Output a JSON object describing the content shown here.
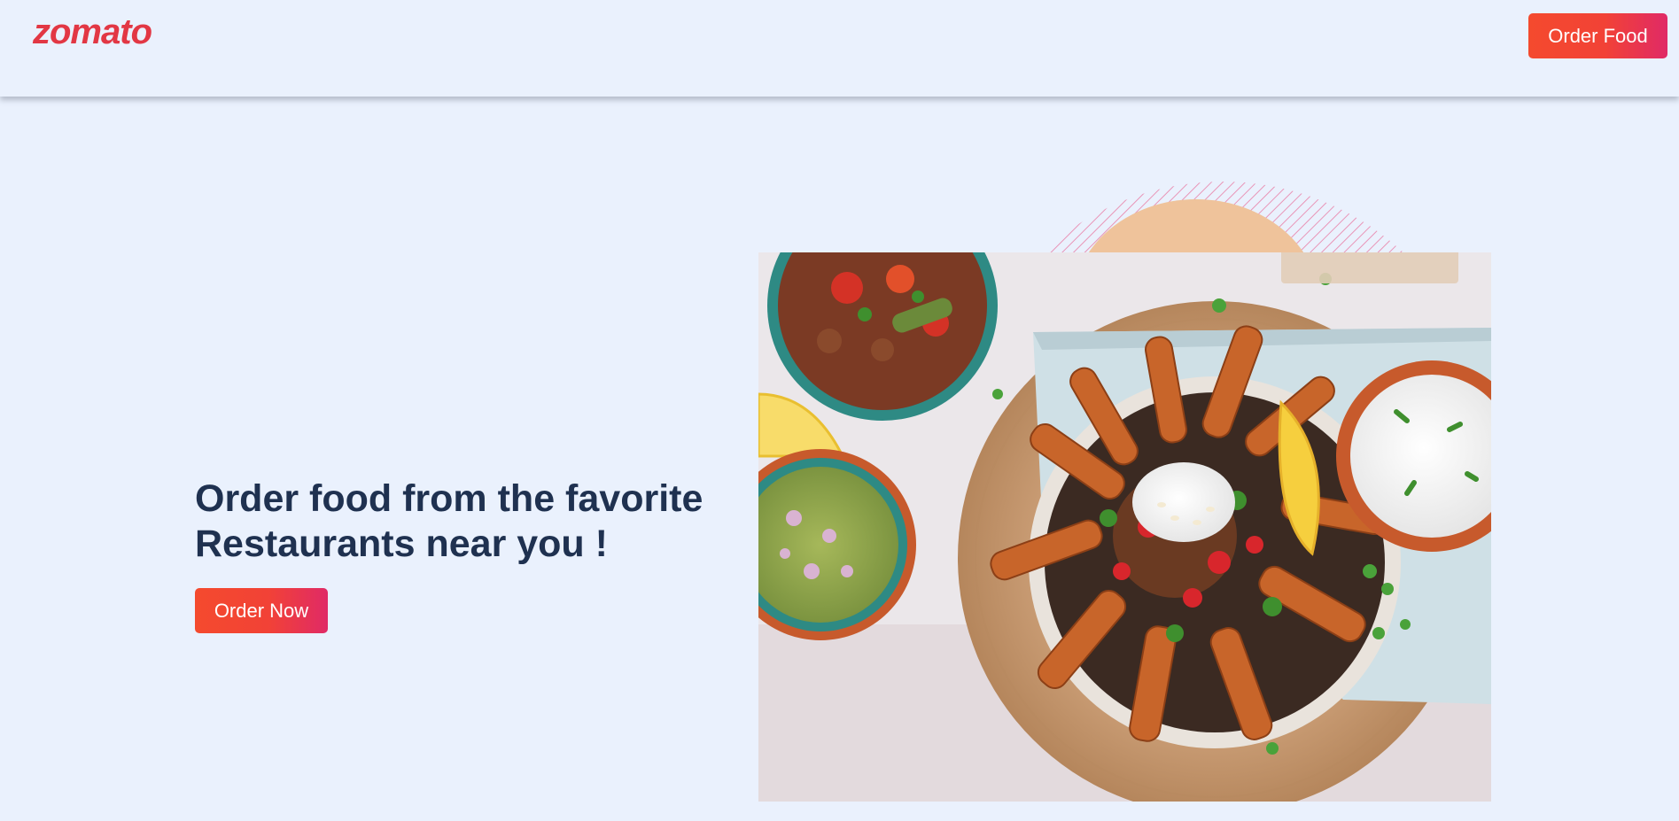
{
  "header": {
    "logo_text": "zomato",
    "order_food_label": "Order Food"
  },
  "hero": {
    "title_line1": "Order food from the favorite",
    "title_line2": "Restaurants near you !",
    "order_now_label": "Order Now"
  },
  "colors": {
    "background": "#eaf1fd",
    "brand_red": "#e23744",
    "button_gradient_start": "#f44a2e",
    "button_gradient_end": "#e02a66",
    "title_text": "#1f3150",
    "decor_peach": "#efc39b",
    "decor_hatch": "#e98bb0"
  },
  "icons": {
    "logo": "zomato-logo"
  }
}
